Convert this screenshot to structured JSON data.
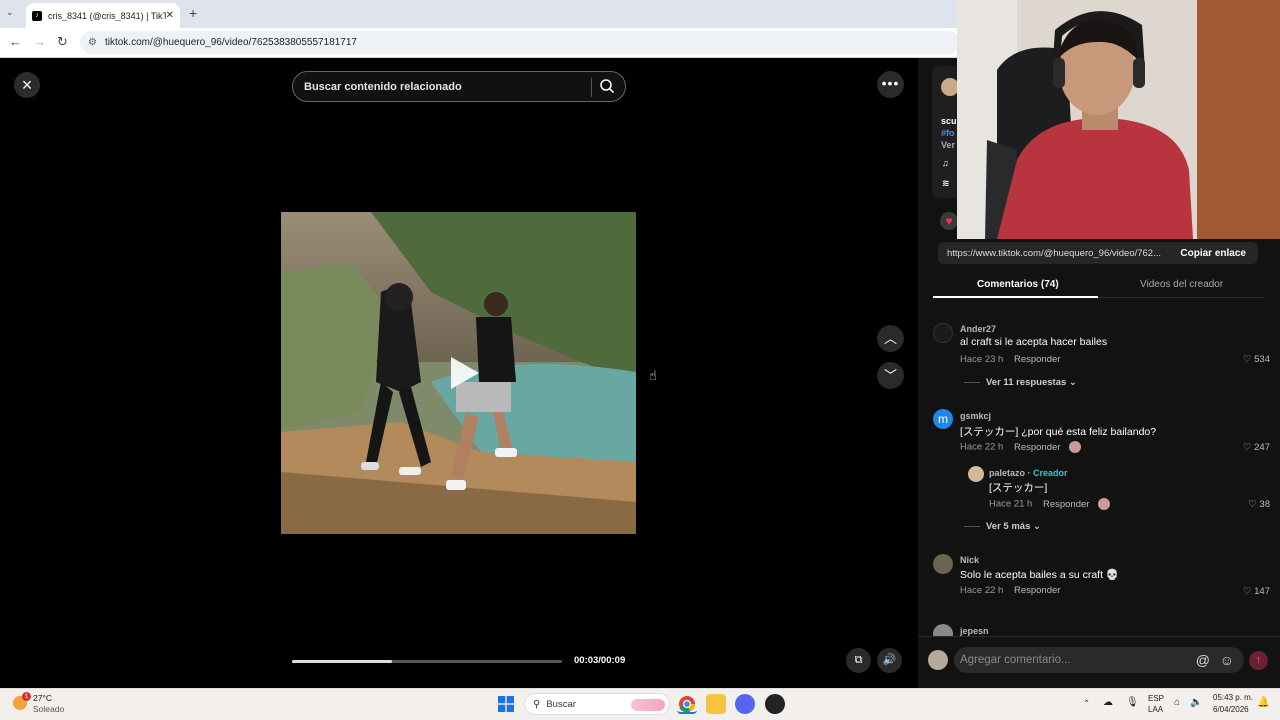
{
  "browser": {
    "tab_title": "cris_8341 (@cris_8341) | TikTok",
    "tab_close": "✕",
    "new_tab": "+",
    "url": "tiktok.com/@huequero_96/video/7625383805557181717"
  },
  "viewer": {
    "search_placeholder": "Buscar contenido relacionado",
    "time": "00:03/00:09",
    "progress": 0.37
  },
  "panel": {
    "info_lines": [
      "scu",
      "#fo",
      "Ver"
    ],
    "share_url": "https://www.tiktok.com/@huequero_96/video/762...",
    "copy_label": "Copiar enlace",
    "tabs": [
      "Comentarios (74)",
      "Videos del creador"
    ],
    "comments": [
      {
        "user": "Ander27",
        "text": "al craft si le acepta hacer bailes",
        "time": "Hace 23 h",
        "reply": "Responder",
        "likes": "534",
        "more": "Ver 11 respuestas"
      },
      {
        "user": "gsmkcj",
        "text": "[ステッカー] ¿por qué esta feliz bailando?",
        "time": "Hace 22 h",
        "reply": "Responder",
        "likes": "247"
      },
      {
        "user": "paletazo",
        "badge": "Creador",
        "text": "[ステッカー]",
        "time": "Hace 21 h",
        "reply": "Responder",
        "likes": "38",
        "more": "Ver 5 más"
      },
      {
        "user": "Nick",
        "text": "Solo le acepta bailes a su craft 💀",
        "time": "Hace 22 h",
        "reply": "Responder",
        "likes": "147"
      },
      {
        "user": "jepesn"
      }
    ],
    "comment_placeholder": "Agregar comentario...",
    "avatar_letter": "m"
  },
  "taskbar": {
    "weather_temp": "27°C",
    "weather_desc": "Soleado",
    "search": "Buscar",
    "lang1": "ESP",
    "lang2": "LAA",
    "clock_time": "05:43 p. m.",
    "clock_date": "6/04/2026",
    "badge_count": "1"
  },
  "colors": {
    "accent": "#fe2c55",
    "creator": "#2fc7d6"
  }
}
